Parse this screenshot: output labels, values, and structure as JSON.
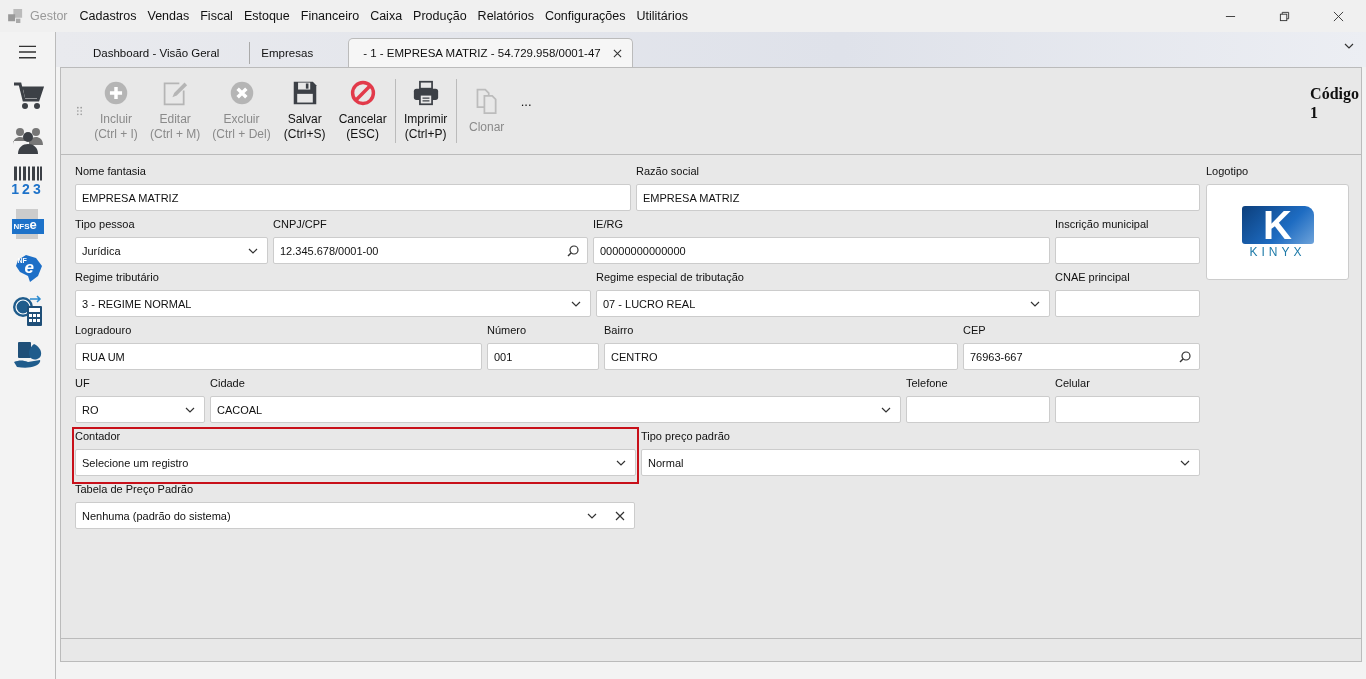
{
  "app": {
    "title": "Gestor"
  },
  "menu": [
    {
      "label": "Cadastros"
    },
    {
      "label": "Vendas"
    },
    {
      "label": "Fiscal"
    },
    {
      "label": "Estoque"
    },
    {
      "label": "Financeiro"
    },
    {
      "label": "Caixa"
    },
    {
      "label": "Produção"
    },
    {
      "label": "Relatórios"
    },
    {
      "label": "Configurações"
    },
    {
      "label": "Utilitários"
    }
  ],
  "sidebar": [
    {
      "kind": "cart"
    },
    {
      "kind": "people"
    },
    {
      "kind": "barcode",
      "text": "123"
    },
    {
      "kind": "nfse",
      "text": "NFS",
      "text_2": "e"
    },
    {
      "kind": "nfe",
      "text": "NF",
      "text_2": "e"
    },
    {
      "kind": "calc"
    },
    {
      "kind": "money"
    }
  ],
  "tabs": [
    {
      "label": "Dashboard - Visão Geral",
      "selected": false,
      "closable": false
    },
    {
      "label": "Empresas",
      "selected": false,
      "closable": false
    },
    {
      "label": "- 1 - EMPRESA MATRIZ - 54.729.958/0001-47",
      "selected": true,
      "closable": true
    }
  ],
  "toolbar": [
    {
      "kind": "add",
      "label": "Incluir",
      "shortcut": "(Ctrl + I)",
      "disabled": true
    },
    {
      "kind": "edit",
      "label": "Editar",
      "shortcut": "(Ctrl + M)",
      "disabled": true
    },
    {
      "kind": "delete",
      "label": "Excluir",
      "shortcut": "(Ctrl + Del)",
      "disabled": true
    },
    {
      "kind": "save",
      "label": "Salvar",
      "shortcut": "(Ctrl+S)",
      "disabled": false
    },
    {
      "kind": "cancel",
      "label": "Cancelar",
      "shortcut": "(ESC)",
      "disabled": false
    },
    {
      "kind": "print",
      "label": "Imprimir",
      "shortcut": "(Ctrl+P)",
      "disabled": false
    },
    {
      "kind": "clone",
      "label": "Clonar",
      "disabled": true
    }
  ],
  "more": "...",
  "code": {
    "label": "Código",
    "value": "1"
  },
  "form": [
    [
      {
        "label": "Nome fantasia",
        "value": "EMPRESA MATRIZ",
        "kind": "text"
      },
      {
        "label": "Razão social",
        "value": "EMPRESA MATRIZ",
        "kind": "text"
      }
    ],
    [
      {
        "label": "Tipo pessoa",
        "value": "Jurídica",
        "kind": "select"
      },
      {
        "label": "CNPJ/CPF",
        "value": "12.345.678/0001-00",
        "kind": "search"
      },
      {
        "label": "IE/RG",
        "value": "00000000000000",
        "kind": "text"
      },
      {
        "label": "Inscrição municipal",
        "kind": "text"
      }
    ],
    [
      {
        "label": "Regime tributário",
        "value": "3 - REGIME NORMAL",
        "kind": "select"
      },
      {
        "label": "Regime especial de tributação",
        "value": "07 - LUCRO REAL",
        "kind": "select"
      },
      {
        "label": "CNAE principal",
        "kind": "text"
      }
    ],
    [
      {
        "label": "Logradouro",
        "value": "RUA UM",
        "kind": "text"
      },
      {
        "label": "Número",
        "value": "001",
        "kind": "text"
      },
      {
        "label": "Bairro",
        "value": "CENTRO",
        "kind": "text"
      },
      {
        "label": "CEP",
        "value": "76963-667",
        "kind": "search"
      }
    ],
    [
      {
        "label": "UF",
        "value": "RO",
        "kind": "select"
      },
      {
        "label": "Cidade",
        "value": "CACOAL",
        "kind": "select"
      },
      {
        "label": "Telefone",
        "kind": "text"
      },
      {
        "label": "Celular",
        "kind": "text"
      }
    ],
    [
      {
        "label": "Contador",
        "value": "Selecione um registro",
        "kind": "select",
        "highlighted": true
      },
      {
        "label": "Tipo preço padrão",
        "value": "Normal",
        "kind": "select",
        "highlighted": false
      }
    ],
    [
      {
        "label": "Tabela de Preço Padrão",
        "value": "Nenhuma (padrão do sistema)",
        "kind": "select_clear"
      }
    ]
  ],
  "logo": {
    "label": "Logotipo",
    "mark": "K",
    "name": "KINYX"
  }
}
